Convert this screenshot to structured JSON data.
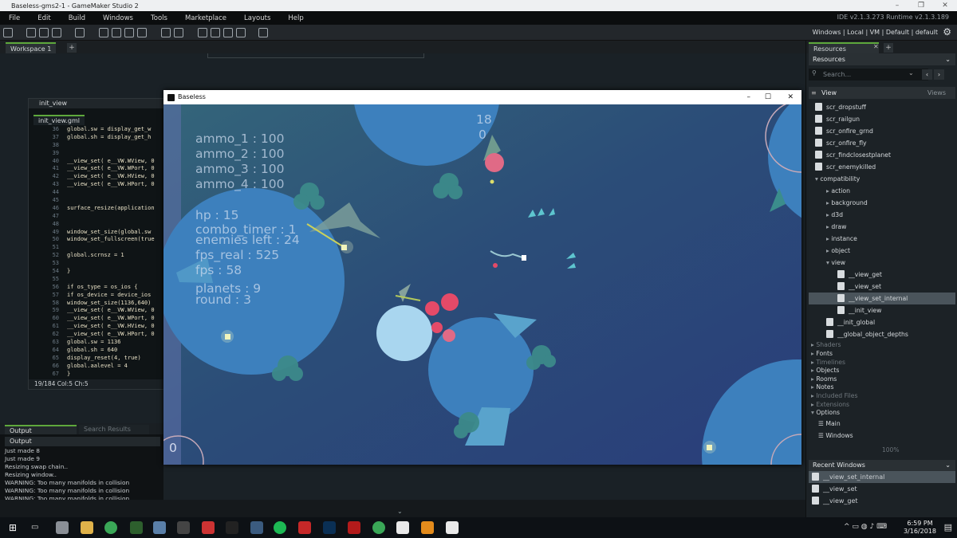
{
  "window": {
    "title": "Baseless-gms2-1 - GameMaker Studio 2"
  },
  "menu": [
    "File",
    "Edit",
    "Build",
    "Windows",
    "Tools",
    "Marketplace",
    "Layouts",
    "Help"
  ],
  "ide_version": "IDE v2.1.3.273 Runtime v2.1.3.189",
  "target_bar": "Windows | Local | VM | Default | default",
  "workspace_tab": "Workspace 1",
  "code_editor": {
    "window_title": "init_view",
    "file_tab": "init_view.gml",
    "lines": [
      {
        "n": "36",
        "t": "global.sw = display_get_w"
      },
      {
        "n": "37",
        "t": "global.sh = display_get_h"
      },
      {
        "n": "38",
        "t": ""
      },
      {
        "n": "39",
        "t": ""
      },
      {
        "n": "40",
        "t": "__view_set( e__VW.WView, 0"
      },
      {
        "n": "41",
        "t": "__view_set( e__VW.WPort, 0"
      },
      {
        "n": "42",
        "t": "__view_set( e__VW.HView, 0"
      },
      {
        "n": "43",
        "t": "__view_set( e__VW.HPort, 0"
      },
      {
        "n": "44",
        "t": ""
      },
      {
        "n": "45",
        "t": ""
      },
      {
        "n": "46",
        "t": "surface_resize(application"
      },
      {
        "n": "47",
        "t": ""
      },
      {
        "n": "48",
        "t": ""
      },
      {
        "n": "49",
        "t": "window_set_size(global.sw"
      },
      {
        "n": "50",
        "t": "window_set_fullscreen(true"
      },
      {
        "n": "51",
        "t": ""
      },
      {
        "n": "52",
        "t": "global.scrnsz = 1"
      },
      {
        "n": "53",
        "t": ""
      },
      {
        "n": "54",
        "t": "}"
      },
      {
        "n": "55",
        "t": ""
      },
      {
        "n": "56",
        "t": "if os_type = os_ios {"
      },
      {
        "n": "57",
        "t": "if os_device = device_ios"
      },
      {
        "n": "58",
        "t": "window_set_size(1136,640)"
      },
      {
        "n": "59",
        "t": "__view_set( e__VW.WView, 0"
      },
      {
        "n": "60",
        "t": "__view_set( e__VW.WPort, 0"
      },
      {
        "n": "61",
        "t": "__view_set( e__VW.HView, 0"
      },
      {
        "n": "62",
        "t": "__view_set( e__VW.HPort, 0"
      },
      {
        "n": "63",
        "t": "global.sw = 1136"
      },
      {
        "n": "64",
        "t": "global.sh = 640"
      },
      {
        "n": "65",
        "t": "display_reset(4, true)"
      },
      {
        "n": "66",
        "t": "global.aalevel = 4"
      },
      {
        "n": "67",
        "t": "}"
      }
    ],
    "status": "19/184 Col:5 Ch:5"
  },
  "output": {
    "tab": "Output",
    "search_tab": "Search Results",
    "sub_label": "Output",
    "lines": [
      "Just made 8",
      "Just made 9",
      "Resizing swap chain..",
      "Resizing window..",
      "WARNING: Too many manifolds in collision",
      "WARNING: Too many manifolds in collision",
      "WARNING: Too many manifolds in collision"
    ]
  },
  "resources": {
    "tab": "Resources",
    "header": "Resources",
    "search_placeholder": "Search...",
    "view_label": "View",
    "views_label": "Views",
    "zoom": "100%",
    "items": [
      {
        "label": "scr_dropstuff",
        "kind": "script"
      },
      {
        "label": "scr_railgun",
        "kind": "script"
      },
      {
        "label": "scr_onfire_grnd",
        "kind": "script"
      },
      {
        "label": "scr_onfire_fly",
        "kind": "script"
      },
      {
        "label": "scr_findclosestplanet",
        "kind": "script"
      },
      {
        "label": "scr_enemykilled",
        "kind": "script"
      },
      {
        "label": "compatibility",
        "kind": "folder"
      },
      {
        "label": "action",
        "kind": "folder"
      },
      {
        "label": "background",
        "kind": "folder"
      },
      {
        "label": "d3d",
        "kind": "folder"
      },
      {
        "label": "draw",
        "kind": "folder"
      },
      {
        "label": "instance",
        "kind": "folder"
      },
      {
        "label": "object",
        "kind": "folder"
      },
      {
        "label": "view",
        "kind": "folder"
      },
      {
        "label": "__view_get",
        "kind": "script"
      },
      {
        "label": "__view_set",
        "kind": "script"
      },
      {
        "label": "__view_set_internal",
        "kind": "script"
      },
      {
        "label": "__init_view",
        "kind": "script"
      },
      {
        "label": "__init_global",
        "kind": "script"
      },
      {
        "label": "__global_object_depths",
        "kind": "script"
      },
      {
        "label": "Shaders",
        "kind": "group-dim"
      },
      {
        "label": "Fonts",
        "kind": "group"
      },
      {
        "label": "Timelines",
        "kind": "group-dim"
      },
      {
        "label": "Objects",
        "kind": "group"
      },
      {
        "label": "Rooms",
        "kind": "group"
      },
      {
        "label": "Notes",
        "kind": "group"
      },
      {
        "label": "Included Files",
        "kind": "group-dim"
      },
      {
        "label": "Extensions",
        "kind": "group-dim"
      },
      {
        "label": "Options",
        "kind": "group"
      },
      {
        "label": "Main",
        "kind": "option"
      },
      {
        "label": "Windows",
        "kind": "option"
      }
    ],
    "recent_header": "Recent Windows",
    "recent": [
      "__view_set_internal",
      "__view_set",
      "__view_get"
    ]
  },
  "game": {
    "window_title": "Baseless",
    "score": "18",
    "score2": "0",
    "corner_value": "0",
    "hud": [
      "ammo_1 : 100",
      "ammo_2 : 100",
      "ammo_3 : 100",
      "ammo_4 : 100",
      "hp : 15",
      "combo_timer : 1",
      "enemies left : 24",
      "fps_real : 525",
      "fps : 58",
      "planets : 9",
      "round : 3"
    ]
  },
  "taskbar": {
    "time": "6:59 PM",
    "date": "3/16/2018"
  }
}
